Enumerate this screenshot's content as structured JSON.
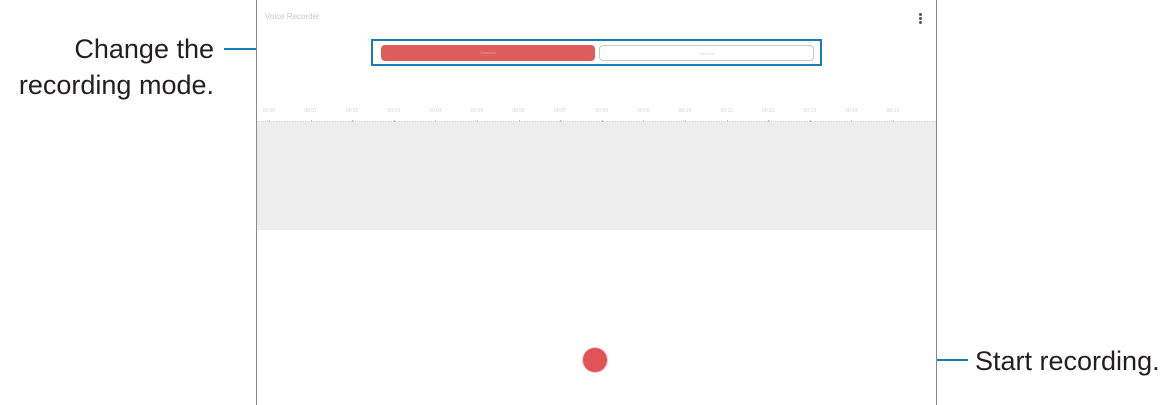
{
  "callouts": {
    "mode_line1": "Change the",
    "mode_line2": "recording mode.",
    "record": "Start recording."
  },
  "app": {
    "title": "Voice Recorder"
  },
  "modes": {
    "standard": "Standard",
    "interview": "Interview"
  },
  "timeline": {
    "ticks": [
      "00:00",
      "00:01",
      "00:02",
      "00:03",
      "00:04",
      "00:05",
      "00:06",
      "00:07",
      "00:08",
      "00:09",
      "00:10",
      "00:11",
      "00:12",
      "00:13",
      "00:14",
      "00:15"
    ]
  },
  "colors": {
    "accent": "#1a7bb7",
    "record": "#e05357",
    "selected_mode": "#de5c5c"
  },
  "icons": {
    "more": "more-options-icon"
  }
}
